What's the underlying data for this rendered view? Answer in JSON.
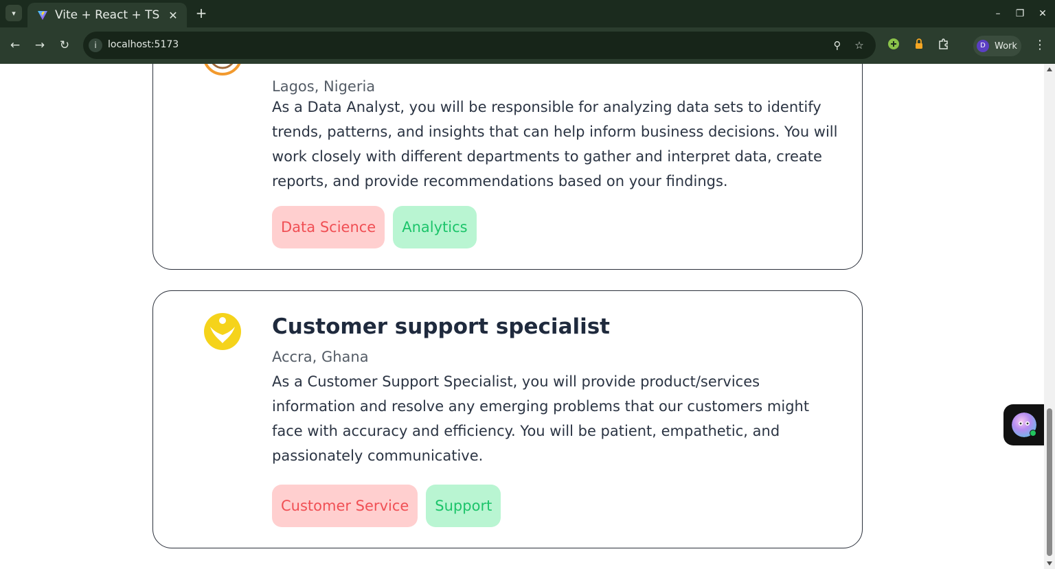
{
  "browser": {
    "tab_title": "Vite + React + TS",
    "tab_close": "✕",
    "new_tab": "+",
    "url": "localhost:5173",
    "profile_initial": "D",
    "profile_label": "Work"
  },
  "jobs": [
    {
      "title": "",
      "location": "Lagos, Nigeria",
      "description": "As a Data Analyst, you will be responsible for analyzing data sets to identify trends, patterns, and insights that can help inform business decisions. You will work closely with different departments to gather and interpret data, create reports, and provide recommendations based on your findings.",
      "tags": [
        "Data Science",
        "Analytics"
      ]
    },
    {
      "title": "Customer support specialist",
      "location": "Accra, Ghana",
      "description": "As a Customer Support Specialist, you will provide product/services information and resolve any emerging problems that our customers might face with accuracy and efficiency. You will be patient, empathetic, and passionately communicative.",
      "tags": [
        "Customer Service",
        "Support"
      ]
    }
  ],
  "colors": {
    "tag_red_bg": "#ffcfcf",
    "tag_red_text": "#f04f54",
    "tag_green_bg": "#b9f5d2",
    "tag_green_text": "#1cc46a",
    "chrome_bg": "#1b2b1e",
    "logo_yellow": "#f5d31b",
    "logo_orange": "#f29a2e"
  },
  "icons": {
    "tab_search": "chevron-down-icon",
    "back": "arrow-left-icon",
    "forward": "arrow-right-icon",
    "reload": "reload-icon",
    "site_info": "info-icon",
    "zoom": "zoom-icon",
    "bookmark": "star-icon",
    "extensions": "puzzle-icon",
    "menu": "more-vertical-icon"
  }
}
